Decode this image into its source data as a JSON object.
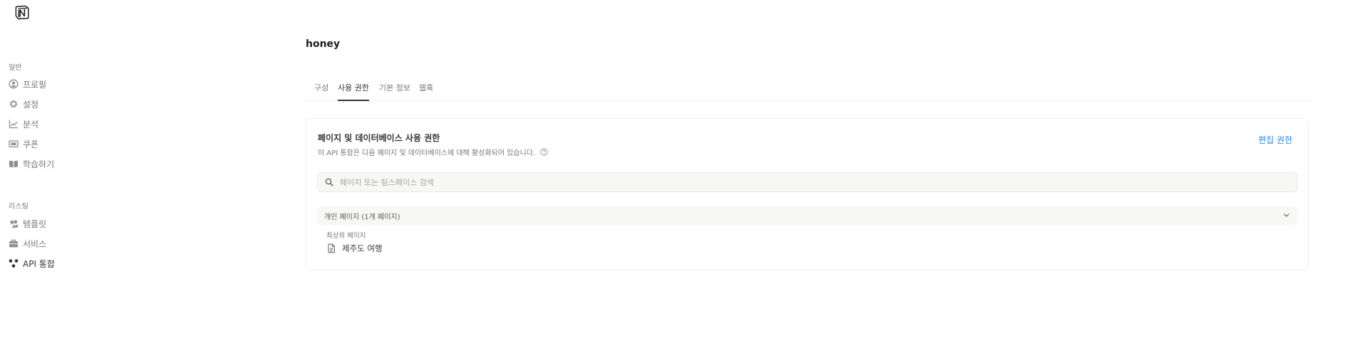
{
  "sidebar": {
    "section_general": "일반",
    "general_items": [
      {
        "label": "프로필",
        "icon": "profile-icon"
      },
      {
        "label": "설정",
        "icon": "gear-icon"
      },
      {
        "label": "분석",
        "icon": "chart-icon"
      },
      {
        "label": "쿠폰",
        "icon": "coupon-icon"
      },
      {
        "label": "학습하기",
        "icon": "book-icon"
      }
    ],
    "section_listing": "리스팅",
    "listing_items": [
      {
        "label": "템플릿",
        "icon": "template-icon"
      },
      {
        "label": "서비스",
        "icon": "briefcase-icon"
      },
      {
        "label": "API 통합",
        "icon": "api-icon",
        "active": true
      }
    ]
  },
  "main": {
    "integration_name": "honey",
    "tabs": [
      {
        "label": "구성"
      },
      {
        "label": "사용 권한",
        "active": true
      },
      {
        "label": "기본 정보"
      },
      {
        "label": "웹훅"
      }
    ],
    "permissions_card": {
      "title": "페이지 및 데이터베이스 사용 권한",
      "description": "이 API 통합은 다음 페이지 및 데이터베이스에 대해 활성화되어 있습니다.",
      "edit_link": "편집 권한",
      "search_placeholder": "페이지 또는 팀스페이스 검색",
      "search_value": "",
      "group_header": "개인 페이지 (1개 페이지)",
      "sub_label": "최상위 페이지",
      "pages": [
        {
          "title": "제주도 여행",
          "icon": "document-icon"
        }
      ]
    }
  },
  "colors": {
    "accent_link": "#2383e2",
    "text_primary": "#37352f",
    "text_secondary": "#787774",
    "surface_gray": "#f7f7f5"
  }
}
